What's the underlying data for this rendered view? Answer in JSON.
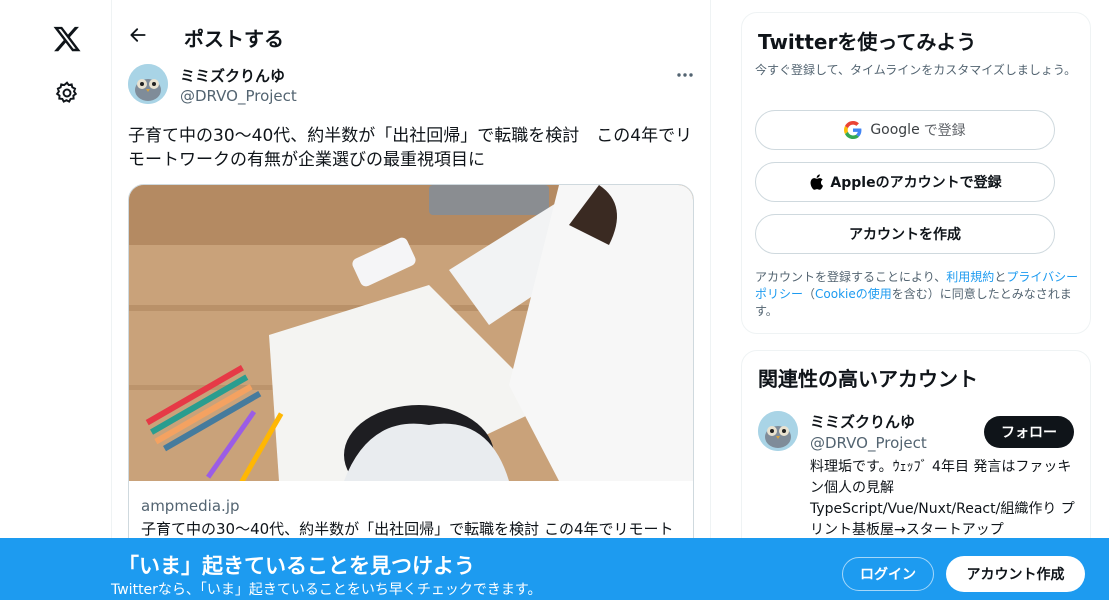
{
  "header": {
    "title": "ポストする"
  },
  "tweet": {
    "author_name": "ミミズクりんゆ",
    "author_handle": "@DRVO_Project",
    "text": "子育て中の30〜40代、約半数が「出社回帰」で転職を検討　この4年でリモートワークの有無が企業選びの最重視項目に",
    "card": {
      "domain": "ampmedia.jp",
      "title": "子育て中の30〜40代、約半数が「出社回帰」で転職を検討 この4年でリモート"
    }
  },
  "signup": {
    "title": "Twitterを使ってみよう",
    "subtitle": "今すぐ登録して、タイムラインをカスタマイズしましょう。",
    "google_brand": "Google",
    "google_label": "で登録",
    "apple_label": "Appleのアカウントで登録",
    "create_label": "アカウントを作成",
    "legal_1": "アカウントを登録することにより、",
    "legal_terms": "利用規約",
    "legal_2": "と",
    "legal_privacy": "プライバシーポリシー",
    "legal_3": "（",
    "legal_cookie": "Cookieの使用",
    "legal_4": "を含む）に同意したとみなされます。"
  },
  "related": {
    "title": "関連性の高いアカウント",
    "name": "ミミズクりんゆ",
    "handle": "@DRVO_Project",
    "follow_label": "フォロー",
    "bio": "料理垢です。ｳｪｯﾌﾞ 4年目 発言はファッキン個人の見解 TypeScript/Vue/Nuxt/React/組織作り プリント基板屋→スタートアップ"
  },
  "banner": {
    "title": "「いま」起きていることを見つけよう",
    "subtitle": "Twitterなら、「いま」起きていることをいち早くチェックできます。",
    "login_label": "ログイン",
    "signup_label": "アカウント作成"
  },
  "icons": {
    "logo": "x-logo-icon",
    "settings": "gear-icon",
    "back": "arrow-left-icon",
    "more": "more-dots-icon"
  },
  "colors": {
    "accent": "#1d9bf0",
    "text": "#0f1419",
    "muted": "#536471"
  }
}
